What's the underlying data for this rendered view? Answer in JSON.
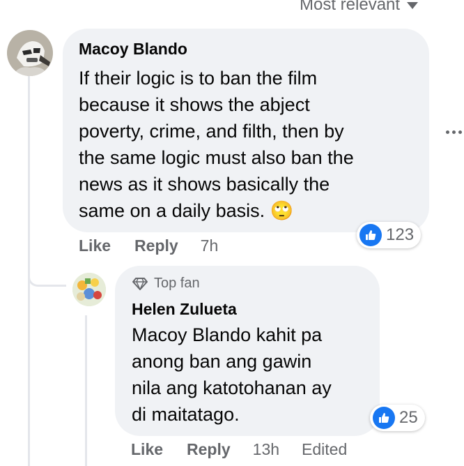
{
  "sort": {
    "label": "Most relevant"
  },
  "comment": {
    "author": "Macoy Blando",
    "lines": [
      "If their logic is to ban the film",
      "because it shows the abject",
      "poverty, crime, and filth, then by",
      "the same logic must also ban the",
      "news as it shows basically the",
      "same on a daily basis."
    ],
    "emoji": "🙄",
    "reaction_count": "123",
    "actions": {
      "like": "Like",
      "reply": "Reply",
      "time": "7h"
    }
  },
  "reply": {
    "badge": "Top fan",
    "author": "Helen Zulueta",
    "lines": [
      "Macoy Blando kahit pa",
      "anong ban ang gawin",
      "nila ang katotohanan ay",
      "di maitatago."
    ],
    "reaction_count": "25",
    "actions": {
      "like": "Like",
      "reply": "Reply",
      "time": "13h",
      "edited": "Edited"
    }
  },
  "colors": {
    "bubble": "#f0f2f5",
    "like_blue": "#1877f2",
    "muted": "#65676b",
    "thread_line": "#e4e6eb"
  },
  "icons": {
    "sort": "chevron-down-icon",
    "like": "thumbs-up-icon",
    "more": "more-options-icon",
    "badge": "diamond-icon"
  }
}
